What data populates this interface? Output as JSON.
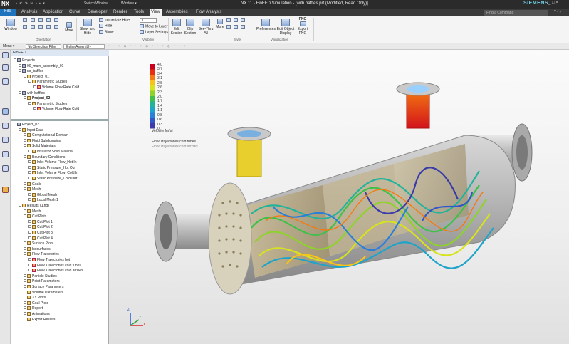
{
  "titlebar": {
    "app": "NX",
    "qa": "▪ ↶ ↷ ✂ ▪ ▪ ▾",
    "switch_window": "Switch Window",
    "window_menu": "Window ▾",
    "title": "NX 11 - FloEFD Simulation - [with baffles.prt (Modified, Read Only)]",
    "brand": "SIEMENS",
    "controls": "_ □ ×"
  },
  "menubar": {
    "tabs": [
      "File",
      "Analysis",
      "Application",
      "Curve",
      "Developer",
      "Render",
      "Tools",
      "View",
      "Assemblies",
      "Flow Analysis"
    ],
    "active": "View",
    "search_placeholder": "Find a Command",
    "controls": "? ▫ ×"
  },
  "ribbon": {
    "window_label": "Window",
    "more1": "More",
    "orientation": "Orientation",
    "show_hide": "Show and Hide",
    "immediate_hide": "Immediate Hide",
    "hide": "Hide",
    "show": "Show",
    "layer_value": "1",
    "move_to_layer": "Move to Layer",
    "layer_settings": "Layer Settings",
    "visibility": "Visibility",
    "edit_section": "Edit Section",
    "clip_section": "Clip Section",
    "see_thru": "See-Thru All",
    "more2": "More",
    "style": "Style",
    "preferences": "Preferences",
    "edit_object_display": "Edit Object Display",
    "export_png_top": "PNG",
    "export_png": "Export PNG",
    "visualization": "Visualization"
  },
  "toolbar": {
    "menu": "Menu ▾",
    "selection_filter": "No Selection Filter",
    "scope": "Entire Assembly"
  },
  "navigator": {
    "header": "FloEFD",
    "projects_tree": [
      {
        "label": "Projects",
        "indent": 0,
        "icon": "bb",
        "bold": false
      },
      {
        "label": "00_main_assembly_01",
        "indent": 1,
        "icon": "bb",
        "bold": false
      },
      {
        "label": "no_baffles",
        "indent": 1,
        "icon": "bb",
        "bold": false
      },
      {
        "label": "Project_01",
        "indent": 2,
        "icon": "b",
        "bold": false
      },
      {
        "label": "Parametric Studies",
        "indent": 3,
        "icon": "b",
        "bold": false
      },
      {
        "label": "Volume Flow Rate Cold",
        "indent": 4,
        "icon": "bo",
        "bold": false
      },
      {
        "label": "with baffles",
        "indent": 1,
        "icon": "bb",
        "bold": false
      },
      {
        "label": "Project_02",
        "indent": 2,
        "icon": "b",
        "bold": true
      },
      {
        "label": "Parametric Studies",
        "indent": 3,
        "icon": "b",
        "bold": false
      },
      {
        "label": "Volume Flow Rate Cold",
        "indent": 4,
        "icon": "bo",
        "bold": false
      }
    ],
    "analysis_tree": [
      {
        "label": "Project_02",
        "indent": 0,
        "icon": "bb"
      },
      {
        "label": "Input Data",
        "indent": 1,
        "icon": "b"
      },
      {
        "label": "Computational Domain",
        "indent": 2,
        "icon": "b"
      },
      {
        "label": "Fluid Subdomains",
        "indent": 2,
        "icon": "b"
      },
      {
        "label": "Solid Materials",
        "indent": 2,
        "icon": "b"
      },
      {
        "label": "Insulator Solid Material 1",
        "indent": 3,
        "icon": "b"
      },
      {
        "label": "Boundary Conditions",
        "indent": 2,
        "icon": "b"
      },
      {
        "label": "Inlet Volume Flow_Hot In",
        "indent": 3,
        "icon": "b"
      },
      {
        "label": "Static Pressure_Hot Out",
        "indent": 3,
        "icon": "b"
      },
      {
        "label": "Inlet Volume Flow_Cold In",
        "indent": 3,
        "icon": "b"
      },
      {
        "label": "Static Pressure_Cold Out",
        "indent": 3,
        "icon": "b"
      },
      {
        "label": "Goals",
        "indent": 2,
        "icon": "b"
      },
      {
        "label": "Mesh",
        "indent": 2,
        "icon": "b"
      },
      {
        "label": "Global Mesh",
        "indent": 3,
        "icon": "b"
      },
      {
        "label": "Local Mesh 1",
        "indent": 3,
        "icon": "b"
      },
      {
        "label": "Results (1.fld)",
        "indent": 1,
        "icon": "b"
      },
      {
        "label": "Mesh",
        "indent": 2,
        "icon": "b"
      },
      {
        "label": "Cut Plots",
        "indent": 2,
        "icon": "b"
      },
      {
        "label": "Cut Plot 1",
        "indent": 3,
        "icon": "b"
      },
      {
        "label": "Cut Plot 2",
        "indent": 3,
        "icon": "b"
      },
      {
        "label": "Cut Plot 3",
        "indent": 3,
        "icon": "b"
      },
      {
        "label": "Cut Plot 4",
        "indent": 3,
        "icon": "b"
      },
      {
        "label": "Surface Plots",
        "indent": 2,
        "icon": "b"
      },
      {
        "label": "Isosurfaces",
        "indent": 2,
        "icon": "b"
      },
      {
        "label": "Flow Trajectories",
        "indent": 2,
        "icon": "b"
      },
      {
        "label": "Flow Trajectories hot",
        "indent": 3,
        "icon": "bo"
      },
      {
        "label": "Flow Trajectories cold tubes",
        "indent": 3,
        "icon": "bo"
      },
      {
        "label": "Flow Trajectories cold arrows",
        "indent": 3,
        "icon": "bo"
      },
      {
        "label": "Particle Studies",
        "indent": 2,
        "icon": "b"
      },
      {
        "label": "Point Parameters",
        "indent": 2,
        "icon": "b"
      },
      {
        "label": "Surface Parameters",
        "indent": 2,
        "icon": "b"
      },
      {
        "label": "Volume Parameters",
        "indent": 2,
        "icon": "b"
      },
      {
        "label": "XY Plots",
        "indent": 2,
        "icon": "b"
      },
      {
        "label": "Goal Plots",
        "indent": 2,
        "icon": "b"
      },
      {
        "label": "Report",
        "indent": 2,
        "icon": "b"
      },
      {
        "label": "Animations",
        "indent": 2,
        "icon": "b"
      },
      {
        "label": "Export Results",
        "indent": 2,
        "icon": "b"
      }
    ]
  },
  "legend": {
    "ticks": [
      "4.0",
      "3.7",
      "3.4",
      "3.1",
      "2.8",
      "2.6",
      "2.3",
      "2.0",
      "1.7",
      "1.4",
      "1.1",
      "0.8",
      "0.6",
      "0.3",
      "0"
    ],
    "title": "Velocity [m/s]",
    "line1": "Flow Trajectories cold tubes",
    "line2": "Flow Trajectories cold arrows",
    "colors": [
      "#c8001e",
      "#e83010",
      "#f47a10",
      "#f7c21a",
      "#d8e31f",
      "#8ed22b",
      "#3fc04a",
      "#23b39a",
      "#1ea3c9",
      "#2a7fd6",
      "#3156c7",
      "#3a3aa8"
    ]
  },
  "triad": {
    "x": "X",
    "y": "Y",
    "z": "Z"
  }
}
